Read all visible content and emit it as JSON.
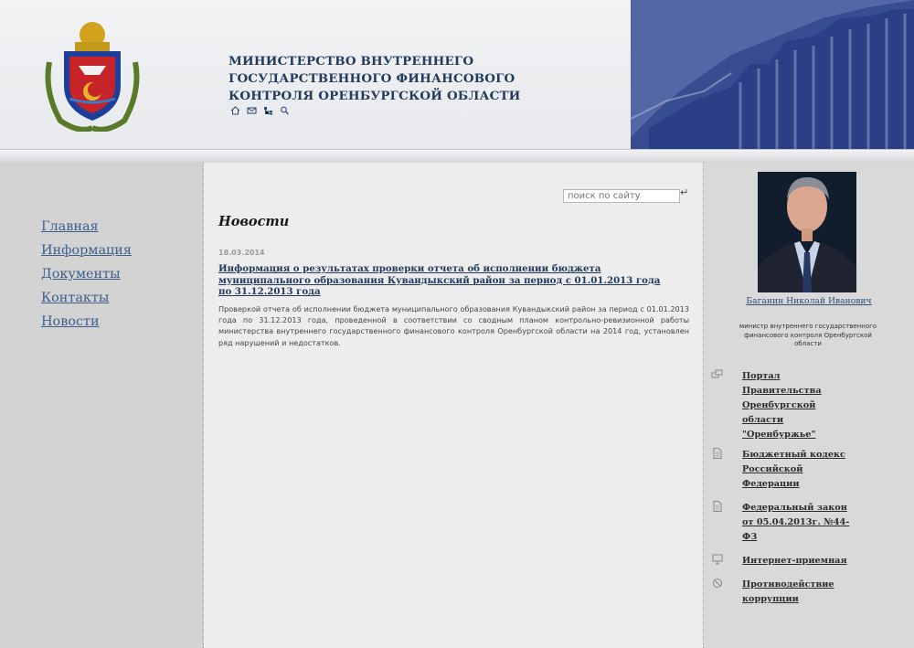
{
  "header": {
    "title": "МИНИСТЕРСТВО ВНУТРЕННЕГО ГОСУДАРСТВЕННОГО ФИНАНСОВОГО КОНТРОЛЯ ОРЕНБУРГСКОЙ ОБЛАСТИ",
    "icons": [
      "home-icon",
      "mail-icon",
      "sitemap-icon",
      "search-icon"
    ]
  },
  "nav": {
    "items": [
      "Главная",
      "Информация",
      "Документы",
      "Контакты",
      "Новости"
    ]
  },
  "search": {
    "placeholder": "поиск по сайту",
    "go_glyph": "↵"
  },
  "news": {
    "heading": "Новости",
    "date": "18.03.2014",
    "title": "Информация о результатах проверки отчета об исполнении бюджета муниципального образования Кувандыкский район за период с 01.01.2013 года по 31.12.2013 года",
    "body": "Проверкой отчета об исполнении бюджета муниципального образования Кувандыкский район за период с 01.01.2013 года по 31.12.2013 года, проведенной в соответствии со сводным планом контрольно-ревизионной работы министерства внутреннего государственного финансового контроля Оренбургской области на 2014 год, установлен ряд нарушений и недостатков."
  },
  "minister": {
    "name": "Баганин Николай  Иванович",
    "post": "министр внутреннего государственного финансового контроля Оренбургской области"
  },
  "links": [
    {
      "label": "Портал Правительства Оренбургской области \"Оренбуржье\"",
      "icon": "portal-icon"
    },
    {
      "label": "Бюджетный кодекс Российской Федерации",
      "icon": "document-icon"
    },
    {
      "label": "Федеральный закон от 05.04.2013г. №44-ФЗ",
      "icon": "document-icon"
    },
    {
      "label": "Интернет-приемная",
      "icon": "monitor-icon"
    },
    {
      "label": "Противодействие коррупции",
      "icon": "no-sign-icon"
    }
  ],
  "colors": {
    "title": "#233b5d",
    "nav_link": "#3d5e8a",
    "header_photo": "#2a3f86"
  }
}
